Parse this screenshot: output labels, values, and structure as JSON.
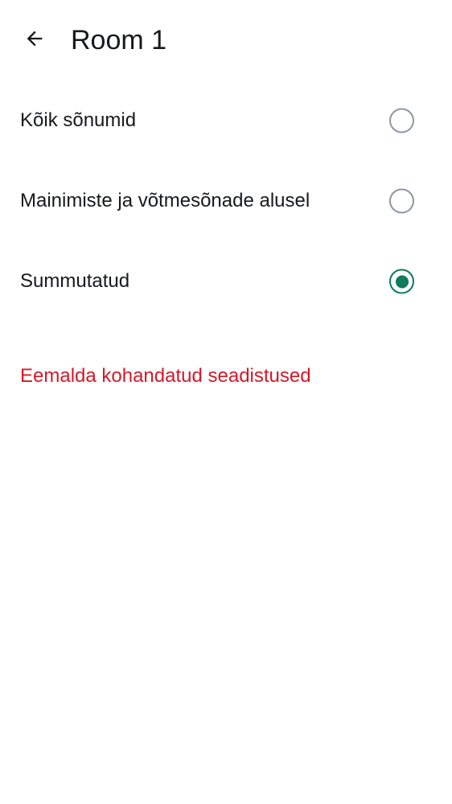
{
  "header": {
    "title": "Room 1",
    "back_icon": "arrow-left-icon"
  },
  "options": [
    {
      "label": "Kõik sõnumid",
      "selected": false
    },
    {
      "label": "Mainimiste ja võtmesõnade alusel",
      "selected": false
    },
    {
      "label": "Summutatud",
      "selected": true
    }
  ],
  "actions": {
    "remove_custom_label": "Eemalda kohandatud seadistused"
  },
  "colors": {
    "accent": "#0f7a5c",
    "danger": "#d51928",
    "radio_unselected": "#8d97a5",
    "text": "#17191c"
  }
}
